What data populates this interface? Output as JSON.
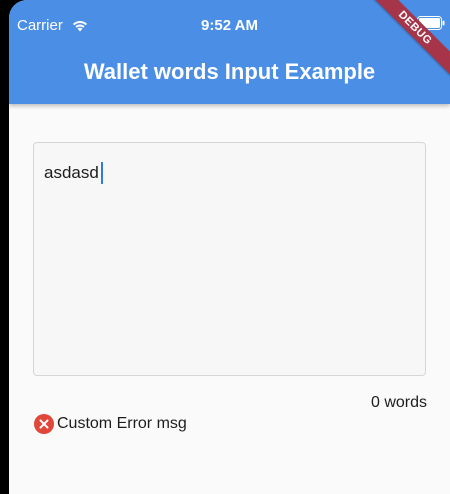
{
  "status_bar": {
    "carrier": "Carrier",
    "time": "9:52 AM",
    "wifi_icon": "wifi-icon",
    "battery_icon": "battery-icon"
  },
  "app_bar": {
    "title": "Wallet words Input Example",
    "color": "#4a8ee6"
  },
  "debug_banner": {
    "label": "DEBUG",
    "color": "#a7354a"
  },
  "words_input": {
    "value": "asdasd",
    "caret_color": "#2f7ae5"
  },
  "word_count": {
    "text": "0 words"
  },
  "error": {
    "icon": "error-circle-icon",
    "message": "Custom Error msg",
    "color": "#e0463a"
  }
}
